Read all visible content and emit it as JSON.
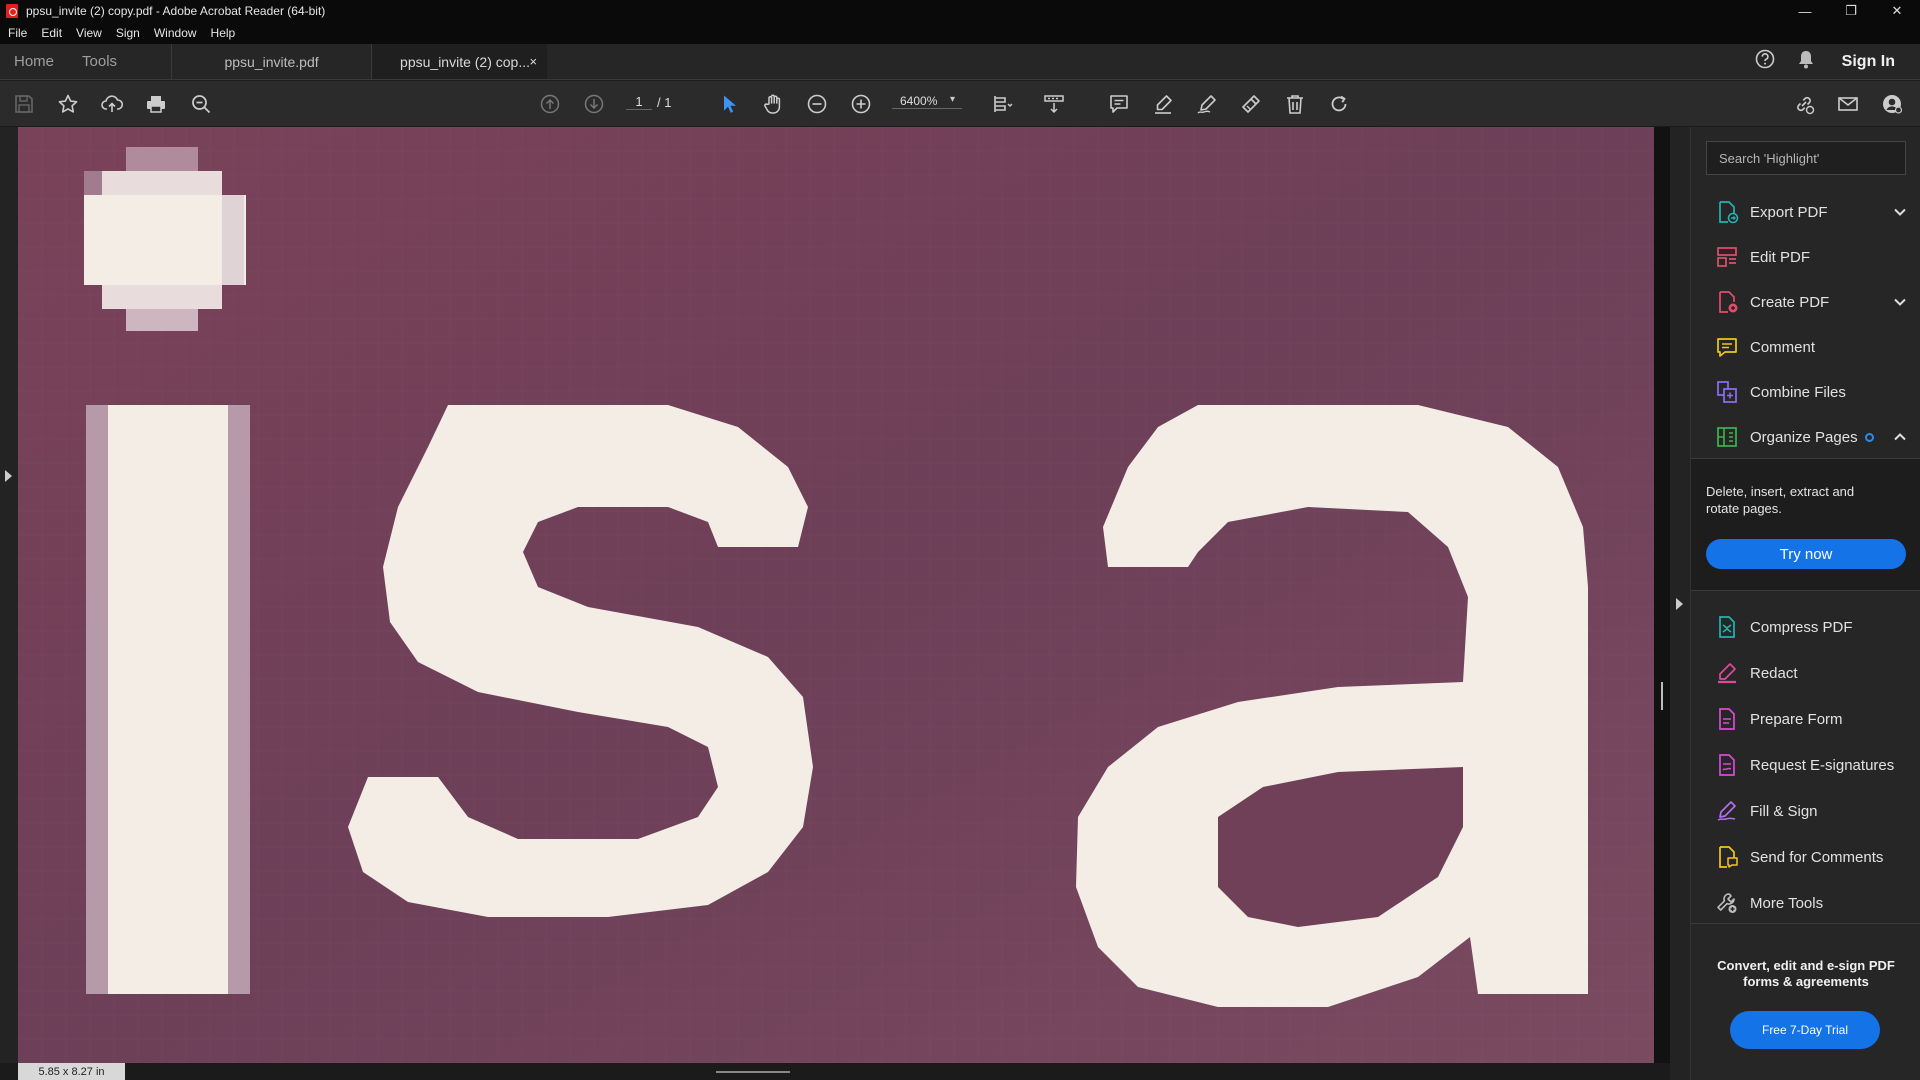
{
  "window": {
    "title": "ppsu_invite (2) copy.pdf - Adobe Acrobat Reader (64-bit)",
    "controls": {
      "minimize": "—",
      "maximize": "❐",
      "close": "✕"
    }
  },
  "menu": [
    "File",
    "Edit",
    "View",
    "Sign",
    "Window",
    "Help"
  ],
  "tabs": {
    "home": "Home",
    "tools": "Tools",
    "documents": [
      {
        "label": "ppsu_invite.pdf",
        "active": false
      },
      {
        "label": "ppsu_invite (2) cop...",
        "active": true,
        "close": "×"
      }
    ],
    "help_icon": "help-circle-icon",
    "notifications_icon": "bell-icon",
    "sign_in": "Sign In"
  },
  "toolbar": {
    "page_current": "1",
    "page_total": "/ 1",
    "zoom": "6400%",
    "zoom_caret": "▾",
    "icons": [
      "save-icon",
      "star-icon",
      "upload-icon",
      "print-icon",
      "find-icon",
      "page-up-icon",
      "page-down-icon",
      "select-arrow-icon",
      "hand-icon",
      "zoom-out-icon",
      "zoom-in-icon",
      "fit-page-icon",
      "scroll-mode-icon",
      "comment-icon",
      "highlight-icon",
      "sign-icon",
      "stamp-icon",
      "delete-icon",
      "rotate-icon",
      "share-link-icon",
      "email-icon",
      "account-icon"
    ]
  },
  "document": {
    "content_text": "isa",
    "page_size": "5.85 x 8.27 in",
    "colors": {
      "background": "#6f4058",
      "glyph": "#f3ede6"
    }
  },
  "right_panel": {
    "search_placeholder": "Search 'Highlight'",
    "tools": [
      {
        "label": "Export PDF",
        "icon": "export-pdf-icon",
        "color": "#23b3b0",
        "expandable": "down"
      },
      {
        "label": "Edit PDF",
        "icon": "edit-pdf-icon",
        "color": "#e24d6b",
        "expandable": ""
      },
      {
        "label": "Create PDF",
        "icon": "create-pdf-icon",
        "color": "#e24d6b",
        "expandable": "down"
      },
      {
        "label": "Comment",
        "icon": "comment-tool-icon",
        "color": "#f2c61a",
        "expandable": ""
      },
      {
        "label": "Combine Files",
        "icon": "combine-files-icon",
        "color": "#8d6ef0",
        "expandable": ""
      },
      {
        "label": "Organize Pages",
        "icon": "organize-pages-icon",
        "color": "#3fb24f",
        "expandable": "up"
      }
    ],
    "organize_desc": "Delete, insert, extract and rotate pages.",
    "try_now": "Try now",
    "more_tools": [
      {
        "label": "Compress PDF",
        "icon": "compress-pdf-icon",
        "color": "#23b3b0"
      },
      {
        "label": "Redact",
        "icon": "redact-icon",
        "color": "#e0489b"
      },
      {
        "label": "Prepare Form",
        "icon": "prepare-form-icon",
        "color": "#d94bd2"
      },
      {
        "label": "Request E-signatures",
        "icon": "request-esign-icon",
        "color": "#d94bd2"
      },
      {
        "label": "Fill & Sign",
        "icon": "fill-sign-icon",
        "color": "#b46cf0"
      },
      {
        "label": "Send for Comments",
        "icon": "send-comments-icon",
        "color": "#f2c61a"
      },
      {
        "label": "More Tools",
        "icon": "more-tools-icon",
        "color": "#bdbdbd"
      }
    ],
    "promo": "Convert, edit and e-sign PDF forms & agreements",
    "trial": "Free 7-Day Trial"
  }
}
